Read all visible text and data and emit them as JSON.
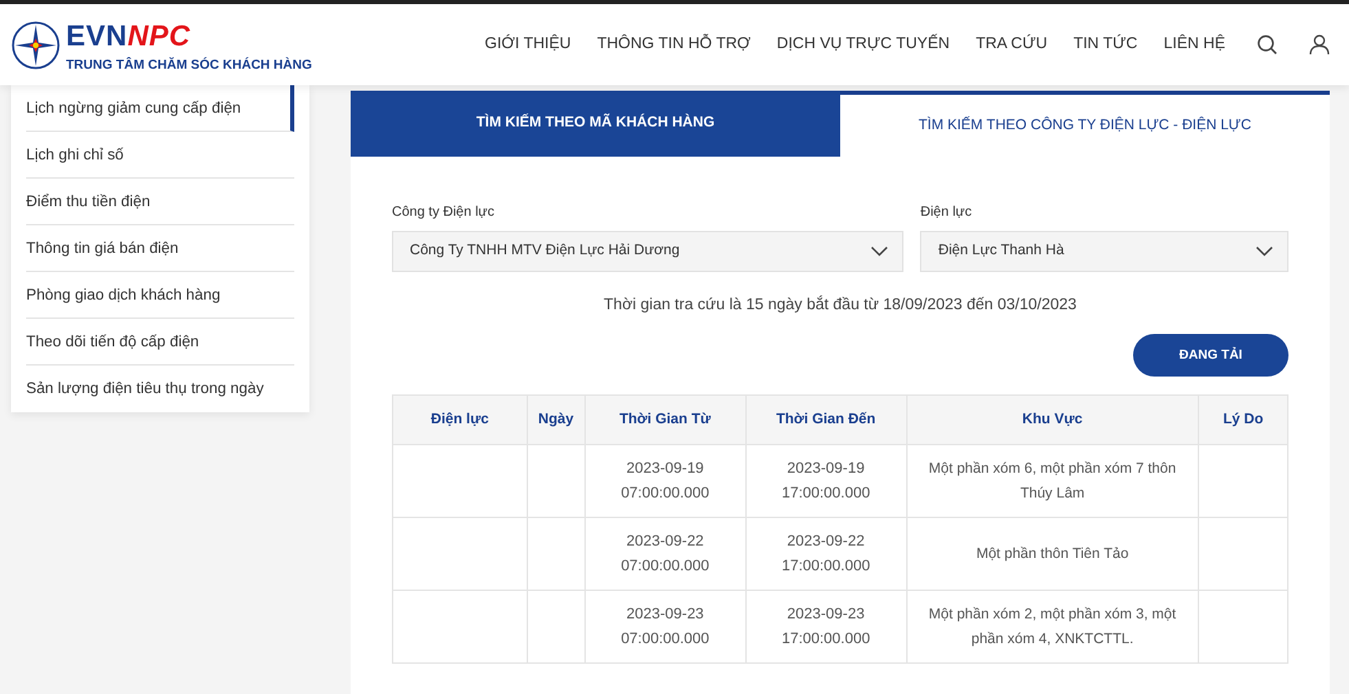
{
  "header": {
    "brand": "EVN",
    "brand_accent": "NPC",
    "subtitle": "TRUNG TÂM CHĂM SÓC KHÁCH HÀNG",
    "nav": [
      "GIỚI THIỆU",
      "THÔNG TIN HỖ TRỢ",
      "DỊCH VỤ TRỰC TUYẾN",
      "TRA CỨU",
      "TIN TỨC",
      "LIÊN HỆ"
    ]
  },
  "sidebar": {
    "items": [
      {
        "label": "Lịch ngừng giảm cung cấp điện",
        "selected": true
      },
      {
        "label": "Lịch ghi chỉ số",
        "selected": false
      },
      {
        "label": "Điểm thu tiền điện",
        "selected": false
      },
      {
        "label": "Thông tin giá bán điện",
        "selected": false
      },
      {
        "label": "Phòng giao dịch khách hàng",
        "selected": false
      },
      {
        "label": "Theo dõi tiến độ cấp điện",
        "selected": false
      },
      {
        "label": "Sản lượng điện tiêu thụ trong ngày",
        "selected": false
      }
    ]
  },
  "tabs": [
    {
      "label": "TÌM KIẾM THEO MÃ KHÁCH HÀNG",
      "selected": true
    },
    {
      "label": "TÌM KIẾM THEO CÔNG TY ĐIỆN LỰC - ĐIỆN LỰC",
      "selected": false
    }
  ],
  "form": {
    "fields": [
      {
        "label": "Công ty Điện lực",
        "value": "Công Ty TNHH MTV Điện Lực Hải Dương"
      },
      {
        "label": "Điện lực",
        "value": "Điện Lực Thanh Hà"
      }
    ],
    "notice": "Thời gian tra cứu là 15 ngày bắt đầu từ 18/09/2023 đến 03/10/2023",
    "button": "ĐANG TẢI"
  },
  "table": {
    "columns": [
      "Điện lực",
      "Ngày",
      "Thời Gian Từ",
      "Thời Gian Đến",
      "Khu Vực",
      "Lý Do"
    ],
    "rows": [
      {
        "time_from": "2023-09-19 07:00:00.000",
        "time_to": "2023-09-19 17:00:00.000",
        "area": "Một phần xóm 6, một phần xóm 7 thôn Thúy Lâm"
      },
      {
        "time_from": "2023-09-22 07:00:00.000",
        "time_to": "2023-09-22 17:00:00.000",
        "area": "Một phần thôn Tiên Tảo"
      },
      {
        "time_from": "2023-09-23 07:00:00.000",
        "time_to": "2023-09-23 17:00:00.000",
        "area": "Một phần xóm 2, một phần xóm 3, một phần xóm 4, XNKTCTTL."
      }
    ]
  }
}
